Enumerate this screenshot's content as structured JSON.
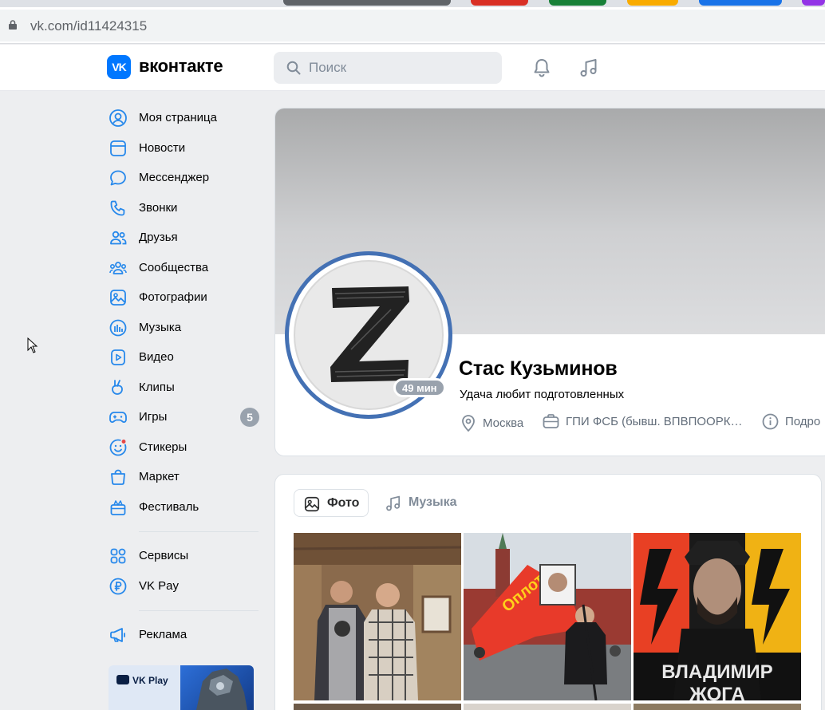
{
  "browser": {
    "url_host": "vk.com/",
    "url_path": "id11424315"
  },
  "header": {
    "logo_mark": "VK",
    "logo_text": "вконтакте",
    "search_placeholder": "Поиск"
  },
  "sidebar": {
    "items": [
      {
        "label": "Моя страница",
        "icon": "user-circle-icon"
      },
      {
        "label": "Новости",
        "icon": "newsfeed-icon"
      },
      {
        "label": "Мессенджер",
        "icon": "message-icon"
      },
      {
        "label": "Звонки",
        "icon": "phone-icon"
      },
      {
        "label": "Друзья",
        "icon": "friends-icon"
      },
      {
        "label": "Сообщества",
        "icon": "communities-icon"
      },
      {
        "label": "Фотографии",
        "icon": "picture-icon"
      },
      {
        "label": "Музыка",
        "icon": "music-icon"
      },
      {
        "label": "Видео",
        "icon": "video-icon"
      },
      {
        "label": "Клипы",
        "icon": "clips-icon"
      },
      {
        "label": "Игры",
        "icon": "gamepad-icon",
        "badge": "5"
      },
      {
        "label": "Стикеры",
        "icon": "smile-icon"
      },
      {
        "label": "Маркет",
        "icon": "bag-icon"
      },
      {
        "label": "Фестиваль",
        "icon": "gift-icon"
      }
    ],
    "extra": [
      {
        "label": "Сервисы",
        "icon": "services-icon"
      },
      {
        "label": "VK Pay",
        "icon": "ruble-icon"
      },
      {
        "label": "Реклама",
        "icon": "megaphone-icon"
      }
    ],
    "promo_label": "VK Play"
  },
  "profile": {
    "name": "Стас Кузьминов",
    "status": "Удача любит подготовленных",
    "online": "49 мин",
    "city": "Москва",
    "work": "ГПИ ФСБ (бывш. ВПВПООРК…",
    "more": "Подро",
    "avatar_letter": "Z"
  },
  "tabs": {
    "photo": "Фото",
    "music": "Музыка"
  },
  "photos": {
    "poster_text_1": "ВЛАДИМИР",
    "poster_text_2": "ЖОГА",
    "flag_text": "Оплот"
  },
  "colors": {
    "accent": "#0077ff",
    "avatar_ring": "#4471b4",
    "badge": "#99a2ad",
    "text_secondary": "#626d7a"
  }
}
